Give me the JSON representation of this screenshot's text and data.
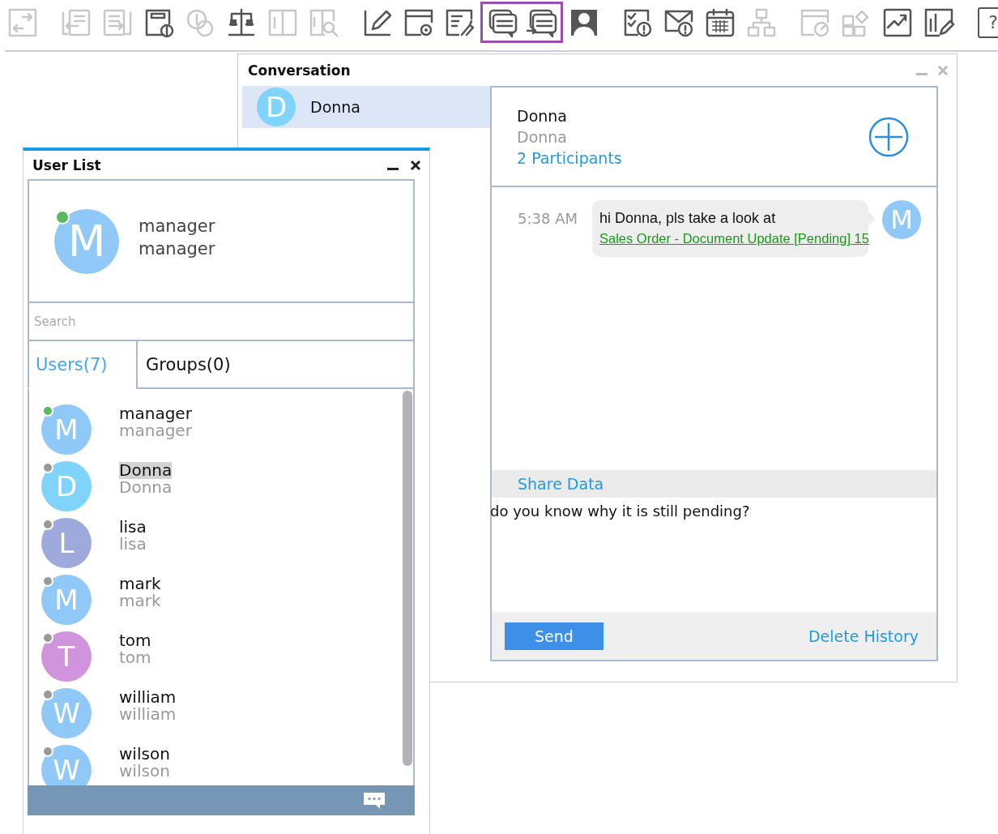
{
  "toolbar": {
    "groups": [
      {
        "buttons": [
          {
            "kind": "icon",
            "disabled": true,
            "selected": false
          }
        ]
      },
      {
        "buttons": [
          {
            "kind": "icon",
            "disabled": true,
            "selected": false
          },
          {
            "kind": "icon",
            "disabled": true,
            "selected": false
          },
          {
            "kind": "icon",
            "disabled": false,
            "selected": false
          },
          {
            "kind": "icon",
            "disabled": true,
            "selected": false
          },
          {
            "kind": "icon",
            "disabled": false,
            "selected": false
          },
          {
            "kind": "icon",
            "disabled": true,
            "selected": false
          },
          {
            "kind": "icon",
            "disabled": true,
            "selected": false
          }
        ]
      },
      {
        "buttons": [
          {
            "kind": "icon",
            "disabled": false,
            "selected": false
          },
          {
            "kind": "icon",
            "disabled": false,
            "selected": false
          },
          {
            "kind": "icon",
            "disabled": false,
            "selected": false
          },
          {
            "kind": "icon",
            "disabled": false,
            "selected": true
          },
          {
            "kind": "icon",
            "disabled": false,
            "selected": true
          },
          {
            "kind": "icon",
            "disabled": false,
            "selected": false
          }
        ]
      },
      {
        "buttons": [
          {
            "kind": "icon",
            "disabled": false,
            "selected": false
          },
          {
            "kind": "icon",
            "disabled": false,
            "selected": false
          },
          {
            "kind": "icon",
            "disabled": false,
            "selected": false
          },
          {
            "kind": "icon",
            "disabled": true,
            "selected": false
          }
        ]
      },
      {
        "buttons": [
          {
            "kind": "icon",
            "disabled": true,
            "selected": false
          },
          {
            "kind": "icon",
            "disabled": true,
            "selected": false
          },
          {
            "kind": "icon",
            "disabled": false,
            "selected": false
          },
          {
            "kind": "icon",
            "disabled": false,
            "selected": false
          }
        ]
      },
      {
        "buttons": [
          {
            "kind": "text",
            "label": "?",
            "disabled": false,
            "selected": false
          }
        ]
      }
    ]
  },
  "conversation": {
    "title": "Conversation",
    "contacts": [
      {
        "initial": "D",
        "name": "Donna",
        "color": "#80d4fc",
        "selected": true
      }
    ],
    "header": {
      "name": "Donna",
      "subtitle": "Donna",
      "participants": "2 Participants"
    },
    "messages": [
      {
        "time": "5:38 AM",
        "text": "hi Donna, pls take a look at",
        "link": "Sales Order - Document Update [Pending] 15",
        "avatar": "M",
        "color": "#90c8f8"
      }
    ],
    "share_label": "Share Data",
    "draft": "do you know why it is still pending?",
    "send": "Send",
    "delete": "Delete History"
  },
  "user_list": {
    "title": "User List",
    "profile": {
      "initial": "M",
      "name": "manager",
      "subtitle": "manager",
      "color": "#90c8f8",
      "online": true
    },
    "search": {
      "placeholder": "Search"
    },
    "tabs": [
      {
        "label": "Users(7)",
        "selected": true
      },
      {
        "label": "Groups(0)",
        "selected": false
      }
    ],
    "users": [
      {
        "initial": "M",
        "name": "manager",
        "subtitle": "manager",
        "color": "#90c8f8",
        "online": true,
        "highlighted": false
      },
      {
        "initial": "D",
        "name": "Donna",
        "subtitle": "Donna",
        "color": "#80d4fc",
        "online": false,
        "highlighted": true
      },
      {
        "initial": "L",
        "name": "lisa",
        "subtitle": "lisa",
        "color": "#9eaadc",
        "online": false,
        "highlighted": false
      },
      {
        "initial": "M",
        "name": "mark",
        "subtitle": "mark",
        "color": "#90c8f8",
        "online": false,
        "highlighted": false
      },
      {
        "initial": "T",
        "name": "tom",
        "subtitle": "tom",
        "color": "#cf94dc",
        "online": false,
        "highlighted": false
      },
      {
        "initial": "W",
        "name": "william",
        "subtitle": "william",
        "color": "#90c8f8",
        "online": false,
        "highlighted": false
      },
      {
        "initial": "W",
        "name": "wilson",
        "subtitle": "wilson",
        "color": "#90c8f8",
        "online": false,
        "highlighted": false
      }
    ]
  }
}
